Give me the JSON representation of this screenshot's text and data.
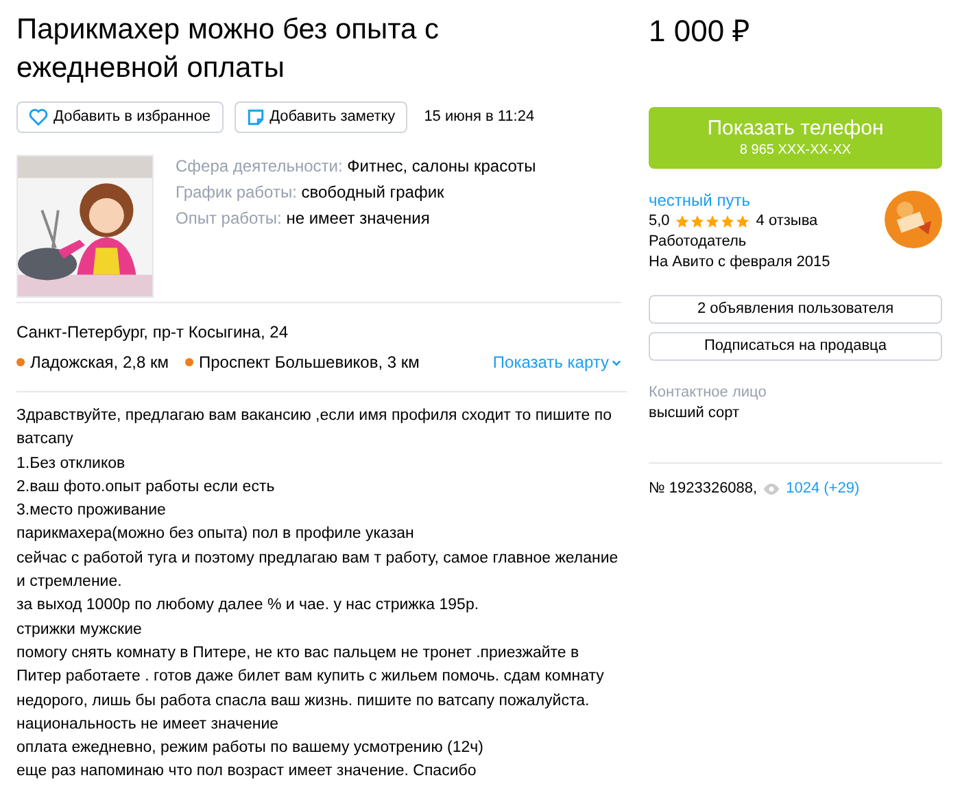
{
  "title": "Парикмахер можно без опыта с ежедневной оплаты",
  "price": "1 000 ₽",
  "actions": [
    {
      "kind": "favorite",
      "label": "Добавить в избранное"
    },
    {
      "kind": "note",
      "label": "Добавить заметку"
    }
  ],
  "date": "15 июня в 11:24",
  "photo": {
    "kind": "picture"
  },
  "params": [
    {
      "label": "Сфера деятельности:",
      "value": "Фитнес, салоны красоты"
    },
    {
      "label": "График работы:",
      "value": "свободный график"
    },
    {
      "label": "Опыт работы:",
      "value": "не имеет значения"
    }
  ],
  "address": "Санкт-Петербург, пр-т Косыгина, 24",
  "metro": [
    {
      "name": "Ладожская, 2,8 км",
      "color": "#f07d1e"
    },
    {
      "name": "Проспект Большевиков, 3 км",
      "color": "#f07d1e"
    }
  ],
  "map_link": "Показать карту",
  "description": [
    "Здравствуйте, предлагаю вам вакансию ,если имя профиля сходит то пишите по ватсапу",
    "1.Без откликов",
    "2.ваш фото.опыт работы если есть",
    "3.место проживание",
    "парикмахера(можно без опыта) пол в профиле указан",
    "сейчас с работой туга и поэтому предлагаю вам т работу, самое главное желание и стремление.",
    "за выход 1000р по любому далее % и чае. у нас стрижка 195р.",
    "стрижки мужские",
    "помогу снять комнату в Питере, не кто вас пальцем не тронет .приезжайте в Питер работаете . готов даже билет вам купить с жильем помочь. сдам комнату недорого, лишь бы работа спасла ваш жизнь. пишите по ватсапу пожалуйста. национальность не имеет значение",
    "оплата ежедневно, режим работы по вашему усмотрению (12ч)",
    "еще раз напоминаю что пол возраст имеет значение. Спасибо"
  ],
  "phone_button": {
    "label": "Показать телефон",
    "number": "8 965 XXX-XX-XX"
  },
  "seller": {
    "name": "честный путь",
    "rating": "5,0",
    "stars": 5,
    "reviews": "4 отзыва",
    "type": "Работодатель",
    "since": "На Авито с февраля 2015"
  },
  "seller_buttons": [
    "2 объявления пользователя",
    "Подписаться на продавца"
  ],
  "contact": {
    "label": "Контактное лицо",
    "value": "высший сорт"
  },
  "ad_number": "№ 1923326088,",
  "views": "1024 (+29)"
}
